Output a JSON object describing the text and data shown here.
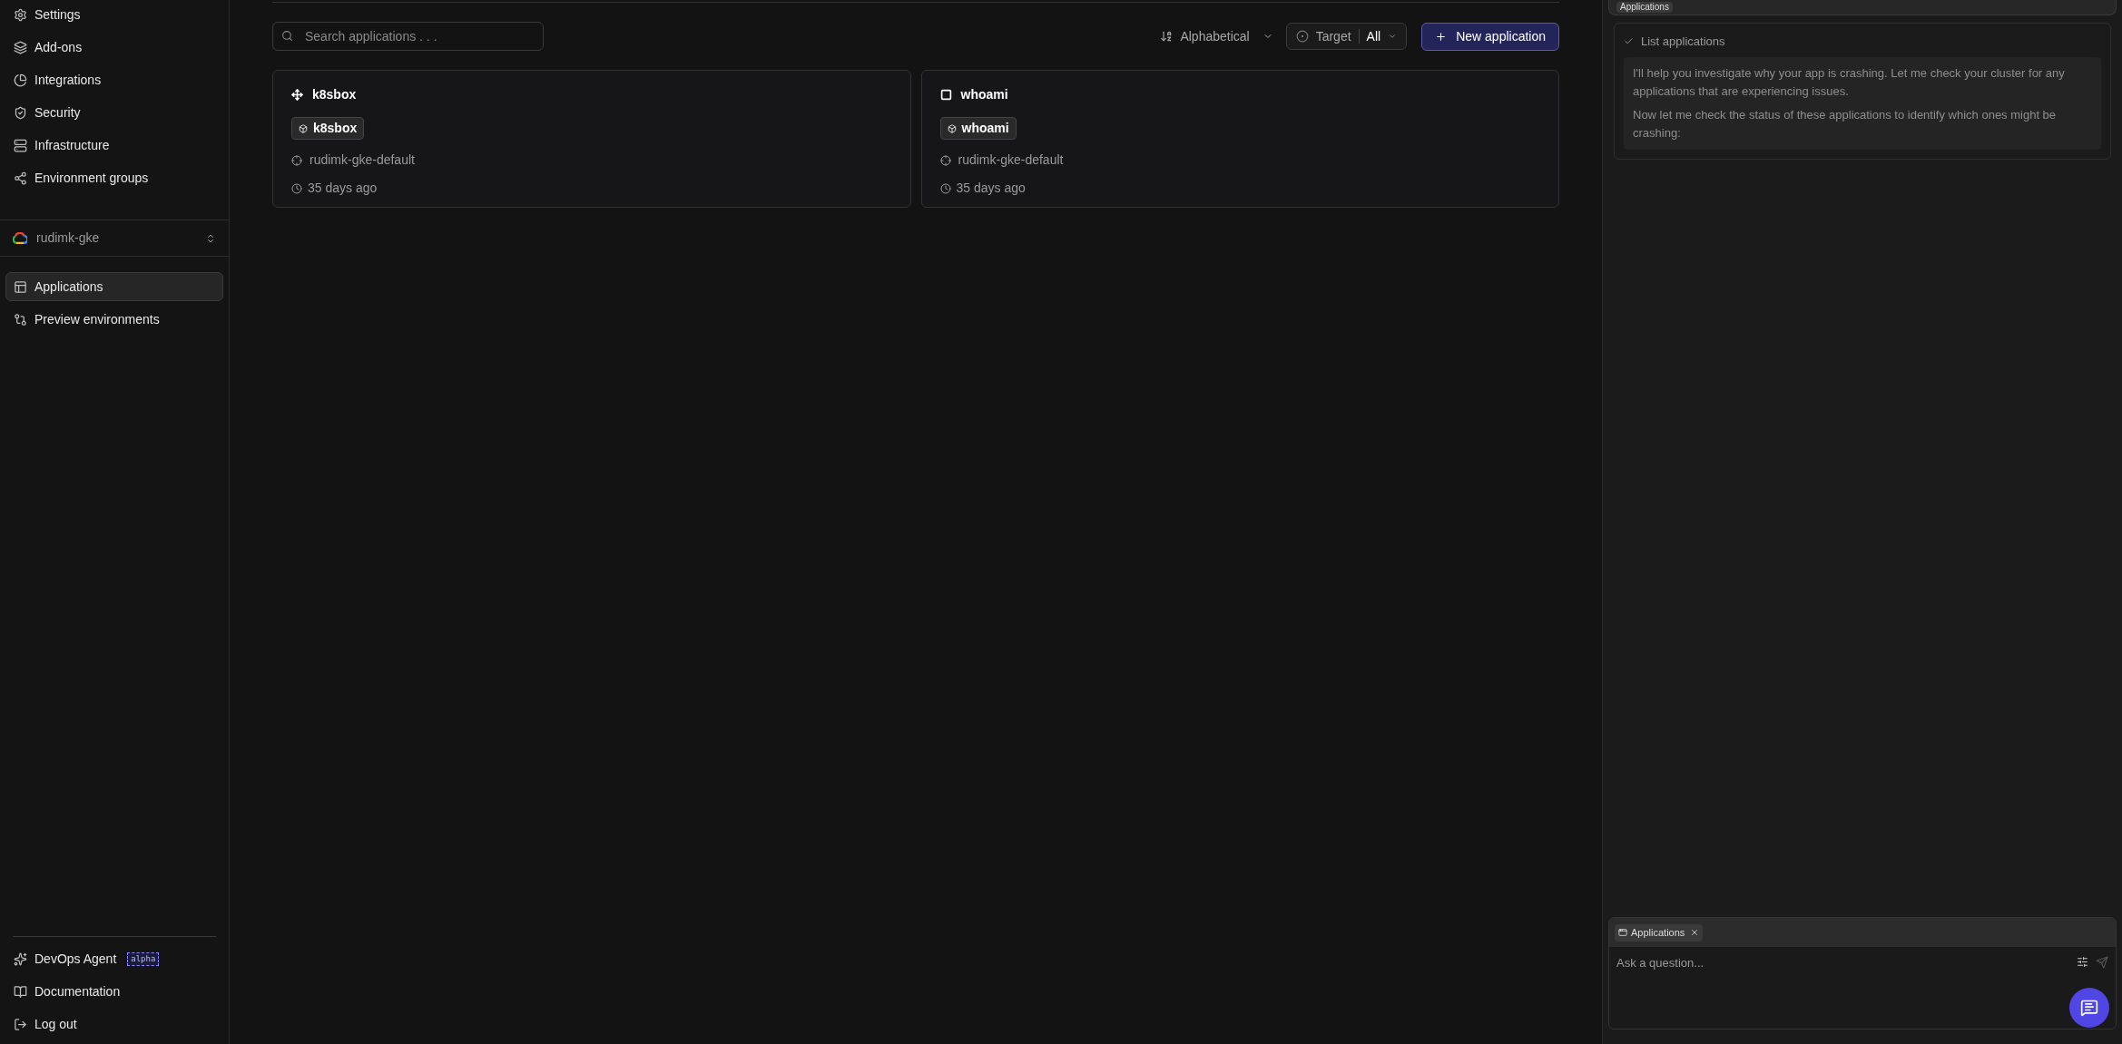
{
  "sidebar": {
    "nav_top": [
      {
        "label": "Settings"
      },
      {
        "label": "Add-ons"
      },
      {
        "label": "Integrations"
      },
      {
        "label": "Security"
      },
      {
        "label": "Infrastructure"
      },
      {
        "label": "Environment groups"
      }
    ],
    "cluster": {
      "name": "rudimk-gke"
    },
    "nav_project": [
      {
        "label": "Applications",
        "selected": true
      },
      {
        "label": "Preview environments",
        "selected": false
      }
    ],
    "nav_bottom": [
      {
        "label": "DevOps Agent",
        "badge": "alpha"
      },
      {
        "label": "Documentation"
      },
      {
        "label": "Log out"
      }
    ]
  },
  "toolbar": {
    "search": {
      "placeholder": "Search applications . . ."
    },
    "sort": {
      "label": "Alphabetical"
    },
    "target": {
      "label": "Target",
      "value": "All"
    },
    "new_button": {
      "label": "New application"
    }
  },
  "applications": [
    {
      "name": "k8sbox",
      "chip": "k8sbox",
      "environment": "rudimk-gke-default",
      "age": "35 days ago"
    },
    {
      "name": "whoami",
      "chip": "whoami",
      "environment": "rudimk-gke-default",
      "age": "35 days ago"
    }
  ],
  "agent_panel": {
    "context_chip": "Applications",
    "step": {
      "label": "List applications",
      "done": true
    },
    "messages": [
      "I'll help you investigate why your app is crashing. Let me check your cluster for any applications that are experiencing issues.",
      "Now let me check the status of these applications to identify which ones might be crashing:"
    ],
    "composer": {
      "chip": "Applications",
      "placeholder": "Ask a question..."
    }
  }
}
